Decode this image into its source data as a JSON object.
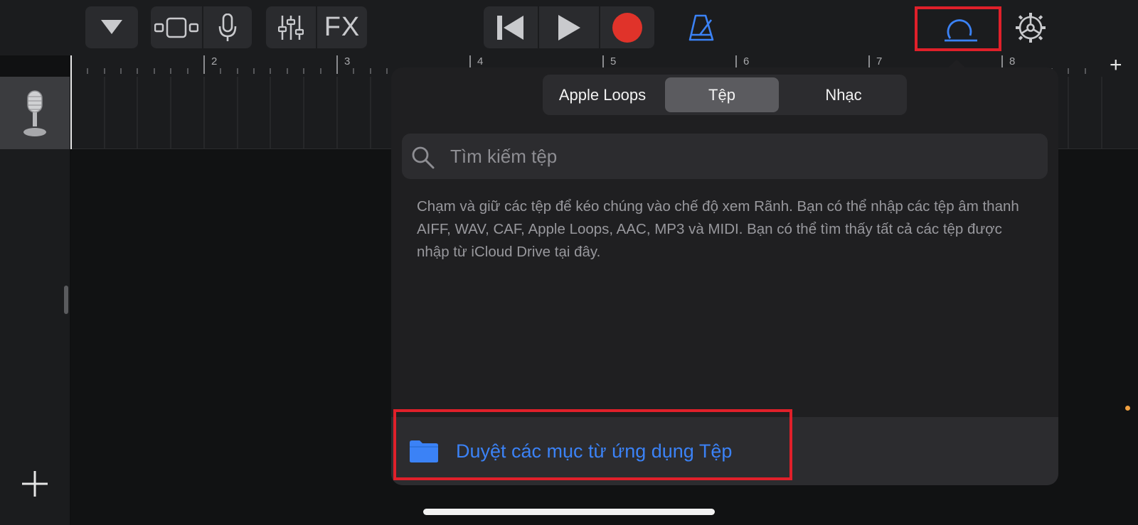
{
  "toolbar": {
    "fx_label": "FX",
    "icons": [
      "triangle-down-icon",
      "tracks-view-icon",
      "microphone-icon",
      "mixer-icon",
      "fx",
      "rewind-icon",
      "play-icon",
      "record-icon",
      "metronome-icon",
      "loop-browser-icon",
      "settings-gear-icon"
    ]
  },
  "ruler": {
    "bars": [
      "2",
      "3",
      "4",
      "5",
      "6",
      "7",
      "8"
    ],
    "add_label": "+"
  },
  "popover": {
    "tabs": [
      {
        "label": "Apple Loops",
        "selected": false
      },
      {
        "label": "Tệp",
        "selected": true
      },
      {
        "label": "Nhạc",
        "selected": false
      }
    ],
    "search": {
      "placeholder": "Tìm kiếm tệp",
      "value": ""
    },
    "help_text": "Chạm và giữ các tệp để kéo chúng vào chế độ xem Rãnh. Bạn có thể nhập các tệp âm thanh AIFF, WAV, CAF, Apple Loops, AAC, MP3 và MIDI. Bạn có thể tìm thấy tất cả các tệp được nhập từ iCloud Drive tại đây.",
    "browse_label": "Duyệt các mục từ ứng dụng Tệp"
  },
  "colors": {
    "accent_blue": "#3b82f6",
    "record_red": "#e0332a",
    "highlight_red": "#e0202a"
  }
}
